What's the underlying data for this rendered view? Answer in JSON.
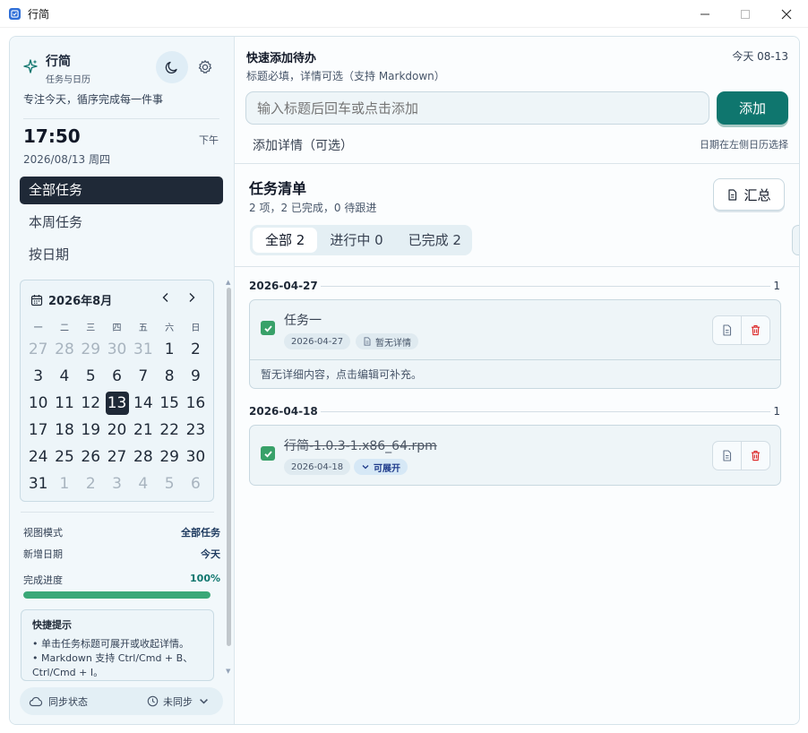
{
  "window": {
    "title": "行简",
    "controls": [
      "minimize",
      "maximize",
      "close"
    ]
  },
  "sidebar": {
    "brand": {
      "name": "行简",
      "subtitle": "任务与日历"
    },
    "motto": "专注今天，循序完成每一件事",
    "clock": {
      "time": "17:50",
      "ampm": "下午",
      "date": "2026/08/13  周四"
    },
    "nav": [
      {
        "label": "全部任务",
        "active": true
      },
      {
        "label": "本周任务",
        "active": false
      },
      {
        "label": "按日期",
        "active": false
      }
    ],
    "calendar": {
      "title": "2026年8月",
      "weekdays": [
        "一",
        "二",
        "三",
        "四",
        "五",
        "六",
        "日"
      ],
      "days": [
        {
          "d": "27",
          "m": true
        },
        {
          "d": "28",
          "m": true
        },
        {
          "d": "29",
          "m": true
        },
        {
          "d": "30",
          "m": true
        },
        {
          "d": "31",
          "m": true
        },
        {
          "d": "1",
          "m": false
        },
        {
          "d": "2",
          "m": false
        },
        {
          "d": "3",
          "m": false
        },
        {
          "d": "4",
          "m": false
        },
        {
          "d": "5",
          "m": false
        },
        {
          "d": "6",
          "m": false
        },
        {
          "d": "7",
          "m": false
        },
        {
          "d": "8",
          "m": false
        },
        {
          "d": "9",
          "m": false
        },
        {
          "d": "10",
          "m": false
        },
        {
          "d": "11",
          "m": false
        },
        {
          "d": "12",
          "m": false
        },
        {
          "d": "13",
          "m": false,
          "today": true
        },
        {
          "d": "14",
          "m": false
        },
        {
          "d": "15",
          "m": false
        },
        {
          "d": "16",
          "m": false
        },
        {
          "d": "17",
          "m": false
        },
        {
          "d": "18",
          "m": false
        },
        {
          "d": "19",
          "m": false
        },
        {
          "d": "20",
          "m": false
        },
        {
          "d": "21",
          "m": false
        },
        {
          "d": "22",
          "m": false
        },
        {
          "d": "23",
          "m": false
        },
        {
          "d": "24",
          "m": false
        },
        {
          "d": "25",
          "m": false
        },
        {
          "d": "26",
          "m": false
        },
        {
          "d": "27",
          "m": false
        },
        {
          "d": "28",
          "m": false
        },
        {
          "d": "29",
          "m": false
        },
        {
          "d": "30",
          "m": false
        },
        {
          "d": "31",
          "m": false
        },
        {
          "d": "1",
          "m": true
        },
        {
          "d": "2",
          "m": true
        },
        {
          "d": "3",
          "m": true
        },
        {
          "d": "4",
          "m": true
        },
        {
          "d": "5",
          "m": true
        },
        {
          "d": "6",
          "m": true
        }
      ]
    },
    "stats": {
      "view_mode_label": "视图模式",
      "view_mode_value": "全部任务",
      "new_date_label": "新增日期",
      "new_date_value": "今天",
      "progress_label": "完成进度",
      "progress_value": "100%",
      "progress_fraction": 1.0
    },
    "tips": {
      "title": "快捷提示",
      "items": [
        "• 单击任务标题可展开或收起详情。",
        "• Markdown 支持 Ctrl/Cmd + B、Ctrl/Cmd + I。"
      ]
    },
    "sync": {
      "label": "同步状态",
      "status": "未同步"
    }
  },
  "quick_add": {
    "title": "快速添加待办",
    "subtitle": "标题必填，详情可选（支持 Markdown）",
    "today": "今天 08-13",
    "placeholder": "输入标题后回车或点击添加",
    "add_label": "添加",
    "detail_toggle": "添加详情（可选）",
    "date_hint": "日期在左侧日历选择"
  },
  "task_list": {
    "title": "任务清单",
    "summary_count": "2 项，2 已完成，0 待跟进",
    "summary_button": "汇总",
    "tabs": [
      {
        "label": "全部 2",
        "active": true
      },
      {
        "label": "进行中 0",
        "active": false
      },
      {
        "label": "已完成 2",
        "active": false
      }
    ],
    "groups": [
      {
        "date": "2026-04-27",
        "count": "1",
        "task": {
          "title": "任务一",
          "date_chip": "2026-04-27",
          "meta_chip": "暂无详情",
          "done": true,
          "detail": "暂无详细内容，点击编辑可补充。"
        }
      },
      {
        "date": "2026-04-18",
        "count": "1",
        "task": {
          "title": "行简-1.0.3-1.x86_64.rpm",
          "date_chip": "2026-04-18",
          "meta_chip": "可展开",
          "done": true
        }
      }
    ]
  },
  "colors": {
    "accent": "#0f766e",
    "nav_active": "#1f2937",
    "progress": "#3aa877",
    "check": "#38a169",
    "delete": "#dc2626"
  }
}
